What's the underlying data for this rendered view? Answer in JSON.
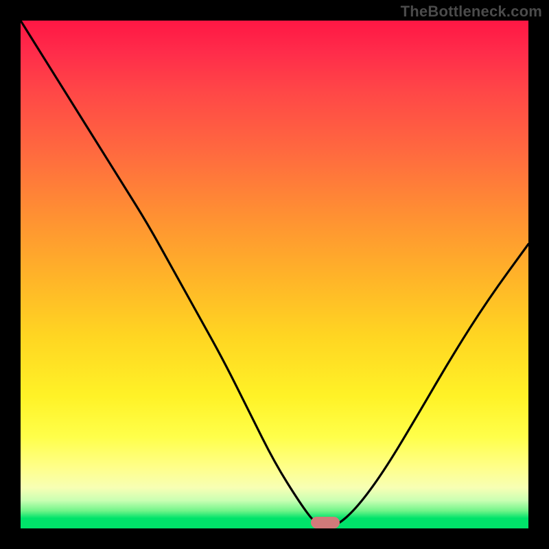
{
  "watermark": "TheBottleneck.com",
  "chart_data": {
    "type": "line",
    "title": "",
    "xlabel": "",
    "ylabel": "",
    "xlim": [
      0,
      100
    ],
    "ylim": [
      0,
      100
    ],
    "grid": false,
    "series": [
      {
        "name": "bottleneck-curve",
        "x": [
          0,
          5,
          10,
          15,
          20,
          25,
          30,
          35,
          40,
          45,
          50,
          55,
          58,
          60,
          63,
          67,
          72,
          78,
          85,
          92,
          100
        ],
        "values": [
          100,
          92,
          84,
          76,
          68,
          60,
          51,
          42,
          33,
          23,
          13,
          5,
          1,
          0,
          1,
          5,
          12,
          22,
          34,
          45,
          56
        ]
      }
    ],
    "optimum_x": 60,
    "marker": {
      "x": 60,
      "y": 0,
      "color": "#d17a7a"
    },
    "background_gradient": {
      "stops": [
        {
          "pos": 0,
          "color": "#ff1744"
        },
        {
          "pos": 0.26,
          "color": "#ff6a3f"
        },
        {
          "pos": 0.5,
          "color": "#ffb229"
        },
        {
          "pos": 0.74,
          "color": "#fff227"
        },
        {
          "pos": 0.92,
          "color": "#f7ffb4"
        },
        {
          "pos": 0.98,
          "color": "#00e36a"
        },
        {
          "pos": 1.0,
          "color": "#00e36a"
        }
      ]
    }
  }
}
